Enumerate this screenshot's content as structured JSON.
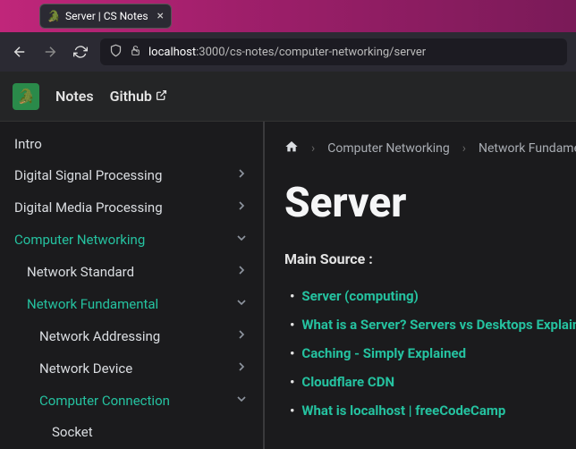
{
  "tab": {
    "title": "Server | CS Notes",
    "icon": "🐊"
  },
  "url": {
    "host": "localhost",
    "rest": ":3000/cs-notes/computer-networking/server"
  },
  "header": {
    "notes": "Notes",
    "github": "Github",
    "logo_emoji": "🐊"
  },
  "sidebar": {
    "items": [
      {
        "label": "Intro",
        "level": 0,
        "expandable": false,
        "active": false
      },
      {
        "label": "Digital Signal Processing",
        "level": 0,
        "expandable": true,
        "open": false,
        "active": false
      },
      {
        "label": "Digital Media Processing",
        "level": 0,
        "expandable": true,
        "open": false,
        "active": false
      },
      {
        "label": "Computer Networking",
        "level": 0,
        "expandable": true,
        "open": true,
        "active": true
      },
      {
        "label": "Network Standard",
        "level": 1,
        "expandable": true,
        "open": false,
        "active": false
      },
      {
        "label": "Network Fundamental",
        "level": 1,
        "expandable": true,
        "open": true,
        "active": true
      },
      {
        "label": "Network Addressing",
        "level": 2,
        "expandable": true,
        "open": false,
        "active": false
      },
      {
        "label": "Network Device",
        "level": 2,
        "expandable": true,
        "open": false,
        "active": false
      },
      {
        "label": "Computer Connection",
        "level": 2,
        "expandable": true,
        "open": true,
        "active": true
      },
      {
        "label": "Socket",
        "level": 3,
        "expandable": false,
        "active": false
      }
    ]
  },
  "breadcrumb": {
    "items": [
      "Computer Networking",
      "Network Fundamental"
    ]
  },
  "page": {
    "title": "Server",
    "main_source_label": "Main Source :",
    "sources": [
      "Server (computing)",
      "What is a Server? Servers vs Desktops Explained",
      "Caching - Simply Explained",
      "Cloudflare CDN",
      "What is localhost | freeCodeCamp"
    ]
  }
}
